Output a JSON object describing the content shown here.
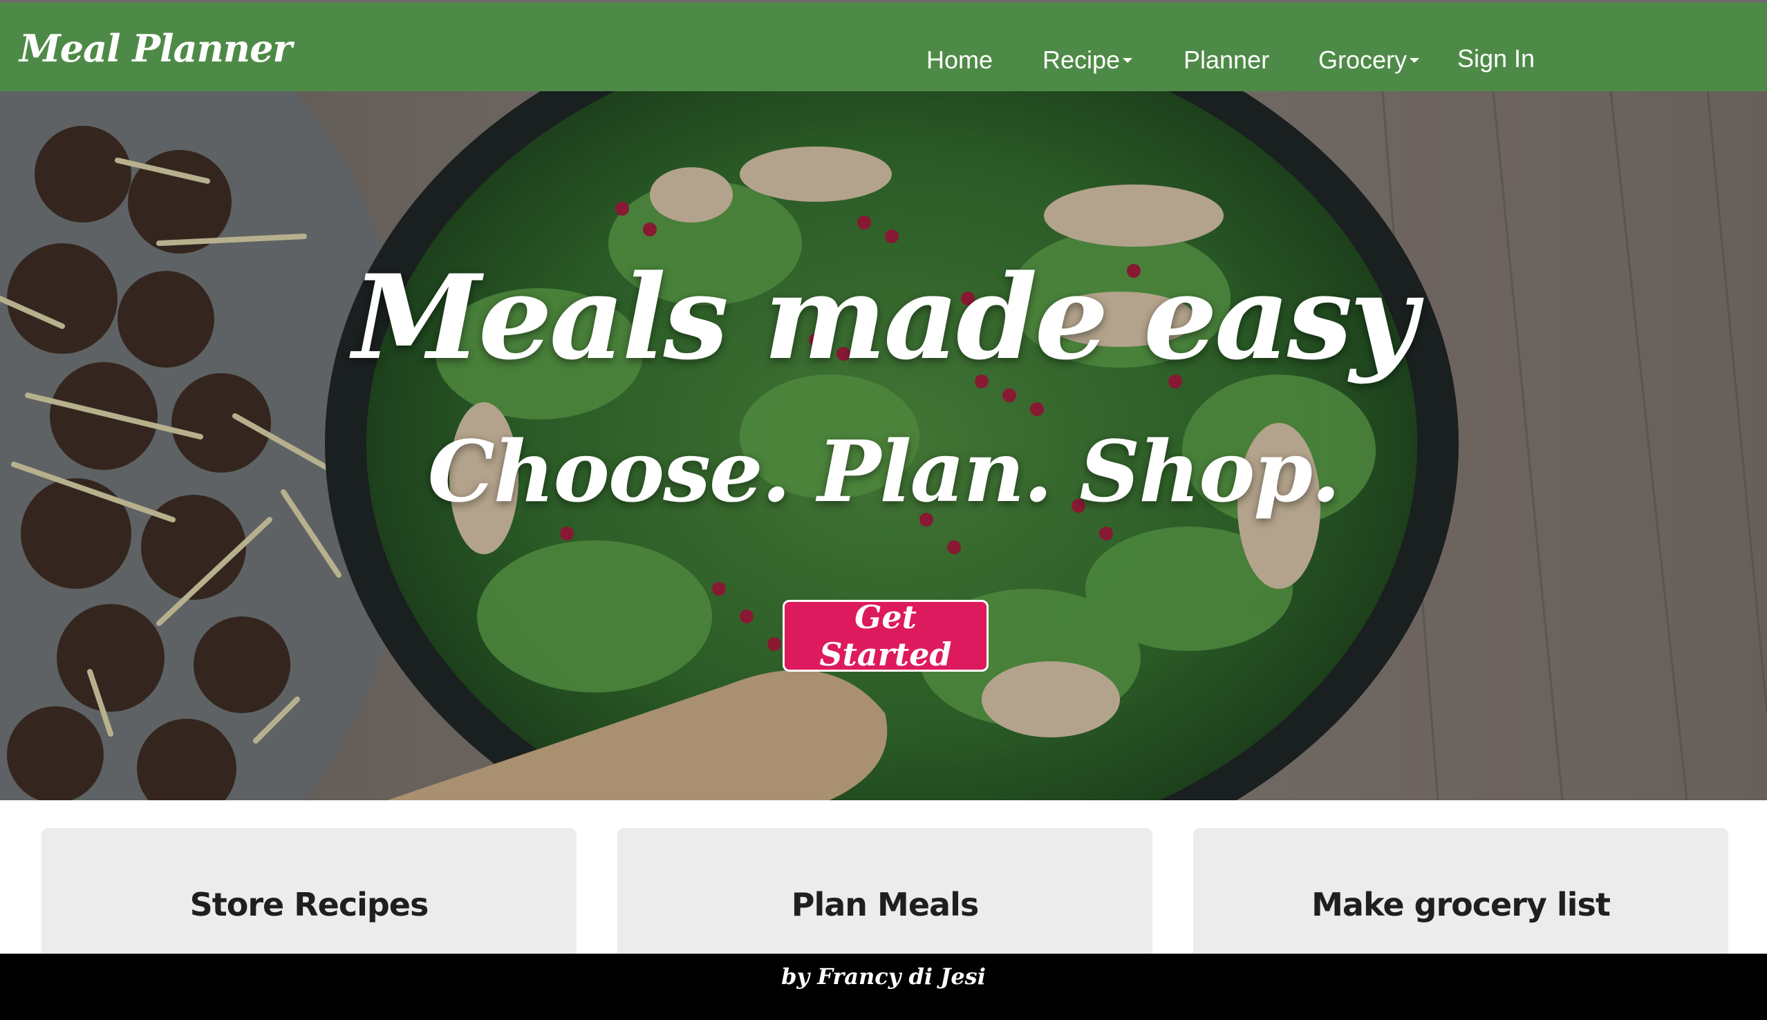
{
  "brand": {
    "name": "Meal Planner"
  },
  "nav": {
    "home": "Home",
    "recipe": "Recipe",
    "planner": "Planner",
    "grocery": "Grocery",
    "sign_in": "Sign In"
  },
  "hero": {
    "title": "Meals made easy",
    "subtitle": "Choose. Plan. Shop.",
    "cta_label": "Get Started"
  },
  "features": [
    {
      "title": "Store Recipes"
    },
    {
      "title": "Plan Meals"
    },
    {
      "title": "Make grocery list"
    }
  ],
  "footer": {
    "credit": "by Francy di Jesi"
  },
  "colors": {
    "navbar": "#4e8a47",
    "cta": "#de1a5e",
    "card": "#ececec",
    "footer": "#000000"
  }
}
